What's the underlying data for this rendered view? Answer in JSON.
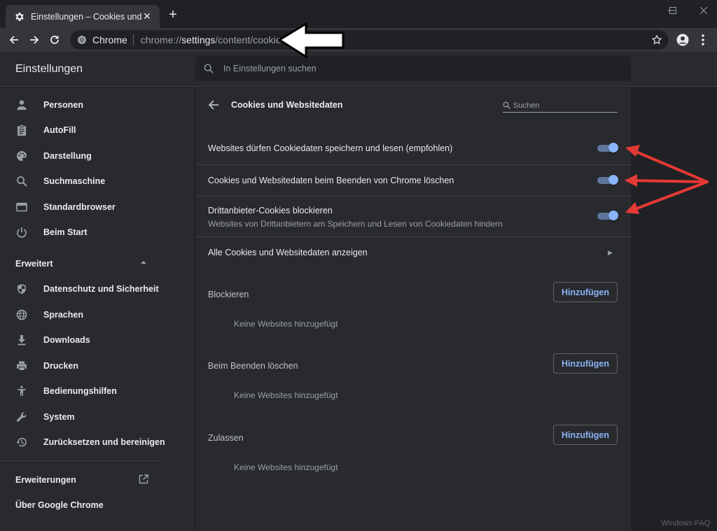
{
  "tab": {
    "title": "Einstellungen – Cookies und Wel",
    "close_glyph": "✕",
    "new_tab_glyph": "+"
  },
  "omnibox": {
    "chip_label": "Chrome",
    "url_prefix": "chrome://",
    "url_host": "settings",
    "url_path": "/content/cookies"
  },
  "header": {
    "title": "Einstellungen",
    "search_placeholder": "In Einstellungen suchen"
  },
  "sidebar": {
    "items": [
      {
        "label": "Personen",
        "icon": "person-icon"
      },
      {
        "label": "AutoFill",
        "icon": "clipboard-icon"
      },
      {
        "label": "Darstellung",
        "icon": "palette-icon"
      },
      {
        "label": "Suchmaschine",
        "icon": "search-icon"
      },
      {
        "label": "Standardbrowser",
        "icon": "browser-icon"
      },
      {
        "label": "Beim Start",
        "icon": "power-icon"
      }
    ],
    "advanced_label": "Erweitert",
    "advanced_items": [
      {
        "label": "Datenschutz und Sicherheit",
        "icon": "shield-icon"
      },
      {
        "label": "Sprachen",
        "icon": "globe-icon"
      },
      {
        "label": "Downloads",
        "icon": "download-icon"
      },
      {
        "label": "Drucken",
        "icon": "printer-icon"
      },
      {
        "label": "Bedienungshilfen",
        "icon": "accessibility-icon"
      },
      {
        "label": "System",
        "icon": "wrench-icon"
      },
      {
        "label": "Zurücksetzen und bereinigen",
        "icon": "restore-icon"
      }
    ],
    "extensions_label": "Erweiterungen",
    "about_label": "Über Google Chrome"
  },
  "main": {
    "title": "Cookies und Websitedaten",
    "search_placeholder": "Suchen",
    "toggles": [
      {
        "label": "Websites dürfen Cookiedaten speichern und lesen (empfohlen)",
        "on": true
      },
      {
        "label": "Cookies und Websitedaten beim Beenden von Chrome löschen",
        "on": true
      },
      {
        "label": "Drittanbieter-Cookies blockieren",
        "sub": "Websites von Drittanbietern am Speichern und Lesen von Cookiedaten hindern",
        "on": true
      }
    ],
    "all_cookies_label": "Alle Cookies und Websitedaten anzeigen",
    "sections": [
      {
        "title": "Blockieren",
        "button": "Hinzufügen",
        "empty": "Keine Websites hinzugefügt"
      },
      {
        "title": "Beim Beenden löschen",
        "button": "Hinzufügen",
        "empty": "Keine Websites hinzugefügt"
      },
      {
        "title": "Zulassen",
        "button": "Hinzufügen",
        "empty": "Keine Websites hinzugefügt"
      }
    ]
  },
  "watermark": "Windows-FAQ",
  "colors": {
    "accent": "#8ab4f8",
    "annotation_arrow": "#e53935",
    "pointer_arrow": "#ffffff"
  }
}
